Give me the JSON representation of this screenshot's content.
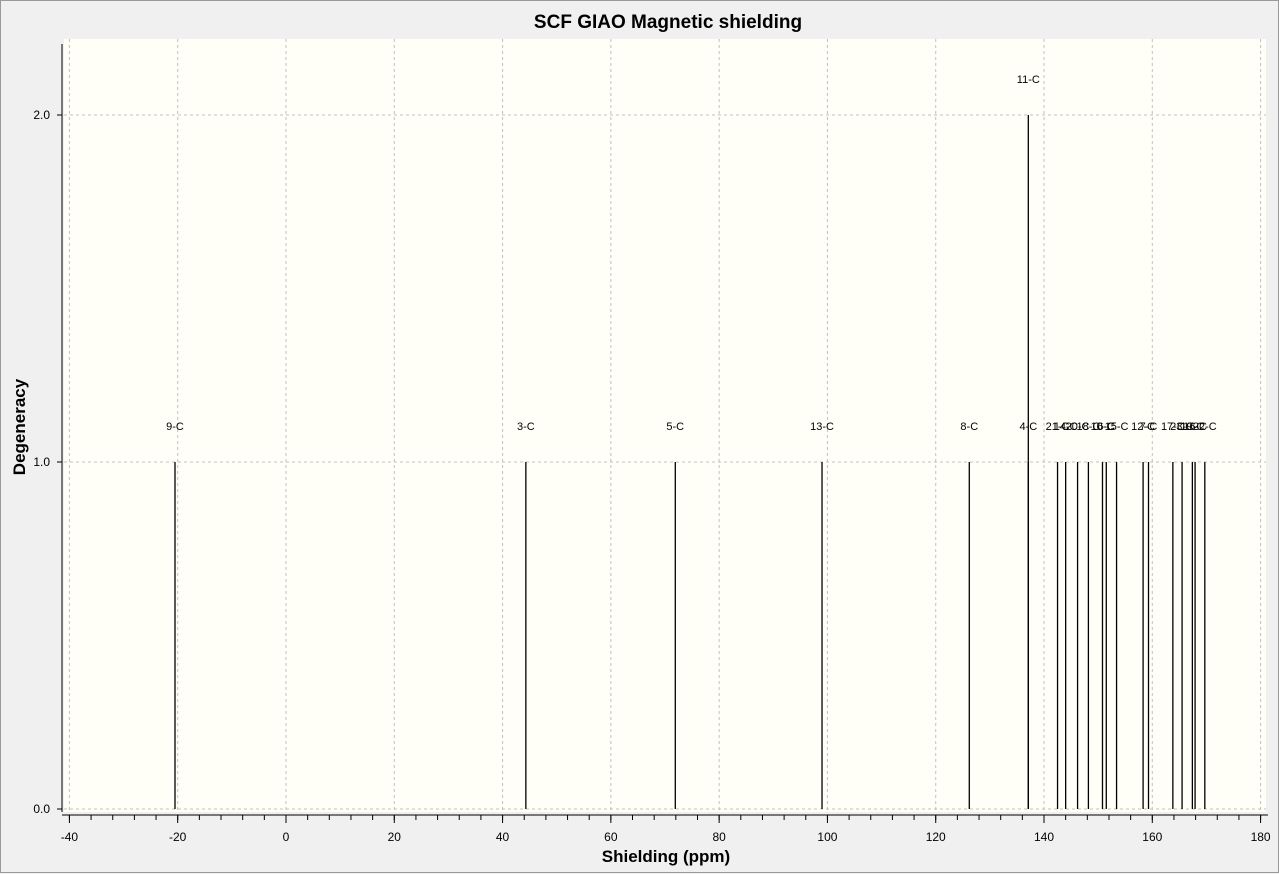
{
  "chart_data": {
    "type": "bar",
    "title": "SCF GIAO Magnetic shielding",
    "xlabel": "Shielding (ppm)",
    "ylabel": "Degeneracy",
    "xlim": [
      -41,
      181
    ],
    "ylim": [
      0,
      2.2
    ],
    "xticks": [
      -40,
      -20,
      0,
      20,
      40,
      60,
      80,
      100,
      120,
      140,
      160,
      180
    ],
    "yticks": [
      0.0,
      1.0,
      2.0
    ],
    "grid": true,
    "colors": {
      "plot_background": "#fffff8",
      "frame_background": "#f0f0f0",
      "grid": "#c0c0c0",
      "line": "#000000"
    },
    "peaks": [
      {
        "label": "9-C",
        "x": -20.5,
        "y": 1
      },
      {
        "label": "3-C",
        "x": 44.3,
        "y": 1
      },
      {
        "label": "5-C",
        "x": 71.9,
        "y": 1
      },
      {
        "label": "13-C",
        "x": 99.0,
        "y": 1
      },
      {
        "label": "8-C",
        "x": 126.2,
        "y": 1
      },
      {
        "label": "11-C",
        "x": 137.1,
        "y": 2
      },
      {
        "label": "4-C",
        "x": 137.1,
        "y": 1
      },
      {
        "label": "21-C",
        "x": 142.5,
        "y": 1
      },
      {
        "label": "14-C",
        "x": 144.0,
        "y": 1
      },
      {
        "label": "20-C",
        "x": 146.2,
        "y": 1
      },
      {
        "label": "18-C",
        "x": 148.2,
        "y": 1
      },
      {
        "label": "10-C",
        "x": 150.8,
        "y": 1
      },
      {
        "label": "6-C",
        "x": 151.5,
        "y": 1
      },
      {
        "label": "15-C",
        "x": 153.4,
        "y": 1
      },
      {
        "label": "12-C",
        "x": 158.3,
        "y": 1
      },
      {
        "label": "7-C",
        "x": 159.3,
        "y": 1
      },
      {
        "label": "17-C",
        "x": 163.8,
        "y": 1
      },
      {
        "label": "23-C",
        "x": 165.5,
        "y": 1
      },
      {
        "label": "19-C",
        "x": 167.4,
        "y": 1
      },
      {
        "label": "16-C",
        "x": 167.9,
        "y": 1
      },
      {
        "label": "22-C",
        "x": 169.7,
        "y": 1
      }
    ]
  }
}
